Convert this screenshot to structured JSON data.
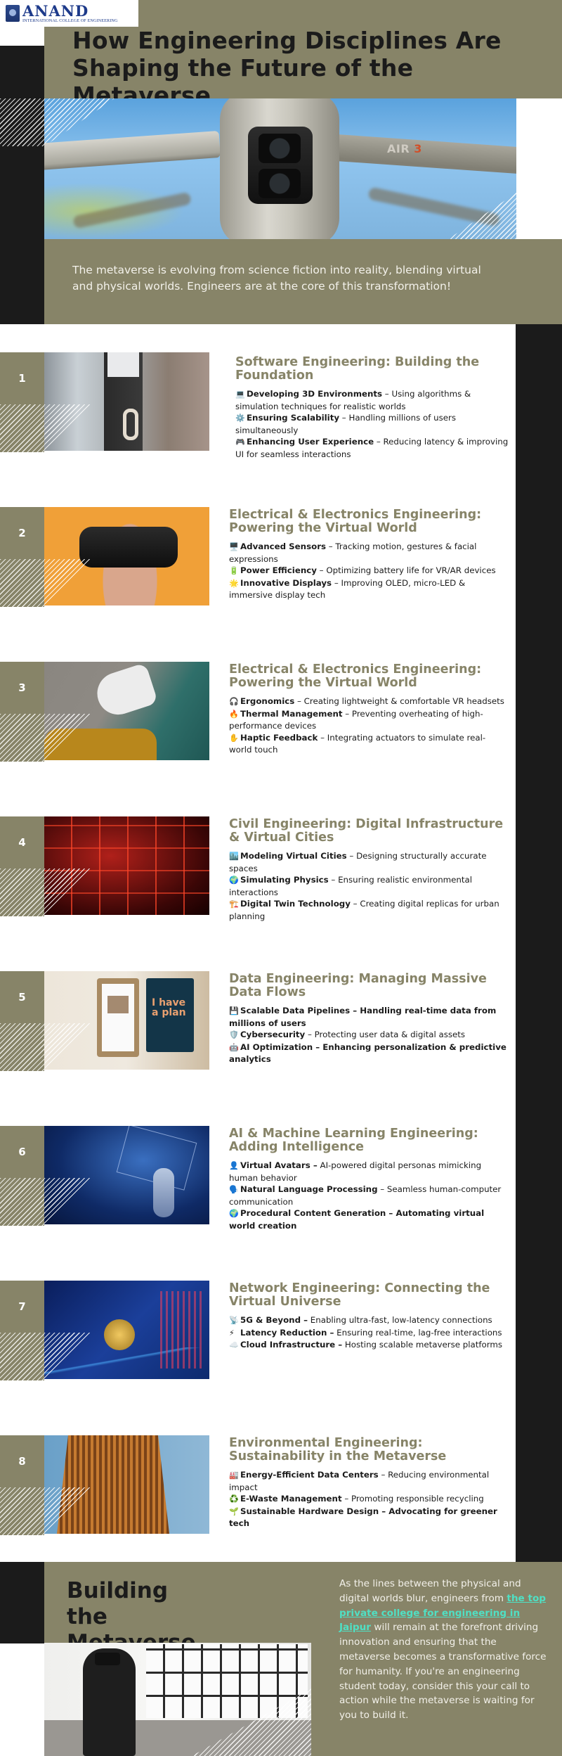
{
  "logo": {
    "name": "ANAND",
    "subtitle": "INTERNATIONAL COLLEGE OF ENGINEERING"
  },
  "header": {
    "title": "How Engineering Disciplines Are Shaping the Future of the Metaverse",
    "hero_image_label": "AIR 3",
    "hero_image_label_accent": "3"
  },
  "intro": {
    "text": "The metaverse is evolving from science fiction into reality, blending virtual and physical worlds. Engineers are at the core of this transformation!"
  },
  "sections": [
    {
      "number": "1",
      "title": "Software Engineering: Building the Foundation",
      "image": "person-holding-vr-headset",
      "items": [
        {
          "icon": "💻",
          "icon_name": "laptop-icon",
          "label": "Developing 3D Environments",
          "text": " – Using algorithms & simulation techniques for realistic worlds"
        },
        {
          "icon": "⚙️",
          "icon_name": "gear-icon",
          "label": "Ensuring Scalability",
          "text": " – Handling millions of users simultaneously"
        },
        {
          "icon": "🎮",
          "icon_name": "game-controller-icon",
          "label": "Enhancing User Experience",
          "text": " – Reducing latency & improving UI for seamless interactions"
        }
      ]
    },
    {
      "number": "2",
      "title": "Electrical & Electronics Engineering: Powering the Virtual World",
      "image": "woman-wearing-vr-headset",
      "items": [
        {
          "icon": "🖥️",
          "icon_name": "desktop-icon",
          "label": "Advanced Sensors",
          "text": " – Tracking motion, gestures & facial expressions"
        },
        {
          "icon": "🔋",
          "icon_name": "battery-icon",
          "label": "Power Efficiency",
          "text": " – Optimizing battery life for VR/AR devices"
        },
        {
          "icon": "🌟",
          "icon_name": "star-icon",
          "label": "Innovative Displays",
          "text": " – Improving OLED, micro-LED & immersive display tech"
        }
      ]
    },
    {
      "number": "3",
      "title": "Electrical & Electronics Engineering: Powering the Virtual World",
      "image": "person-resting-with-vr-headset",
      "items": [
        {
          "icon": "🎧",
          "icon_name": "headphones-icon",
          "label": "Ergonomics",
          "text": " – Creating lightweight & comfortable VR headsets"
        },
        {
          "icon": "🔥",
          "icon_name": "fire-icon",
          "label": "Thermal Management",
          "text": " – Preventing overheating of high-performance devices"
        },
        {
          "icon": "✋",
          "icon_name": "hand-icon",
          "label": "Haptic Feedback",
          "text": " – Integrating actuators to simulate real-world touch"
        }
      ]
    },
    {
      "number": "4",
      "title": "Civil Engineering: Digital Infrastructure & Virtual Cities",
      "image": "red-neon-grid",
      "items": [
        {
          "icon": "🏙️",
          "icon_name": "city-icon",
          "label": "Modeling Virtual Cities",
          "text": " – Designing structurally accurate spaces"
        },
        {
          "icon": "🌍",
          "icon_name": "globe-icon",
          "label": "Simulating Physics",
          "text": " – Ensuring realistic environmental interactions"
        },
        {
          "icon": "🏗️",
          "icon_name": "construction-icon",
          "label": "Digital Twin Technology",
          "text": " – Creating digital replicas for urban planning"
        }
      ]
    },
    {
      "number": "5",
      "title": "Data Engineering: Managing Massive Data Flows",
      "image": "clipboard-and-notebook",
      "items": [
        {
          "icon": "💾",
          "icon_name": "floppy-disk-icon",
          "label": "Scalable Data Pipelines – Handling real-time data from millions of users",
          "text": ""
        },
        {
          "icon": "🛡️",
          "icon_name": "shield-icon",
          "label": "Cybersecurity",
          "text": " – Protecting user data & digital assets"
        },
        {
          "icon": "🤖",
          "icon_name": "robot-icon",
          "label": "AI Optimization – Enhancing personalization & predictive analytics",
          "text": ""
        }
      ]
    },
    {
      "number": "6",
      "title": "AI & Machine Learning Engineering: Adding Intelligence",
      "image": "robot-hand-network",
      "items": [
        {
          "icon": "👤",
          "icon_name": "user-icon",
          "label": "Virtual Avatars –",
          "text": " AI-powered digital personas mimicking human behavior"
        },
        {
          "icon": "🗣️",
          "icon_name": "speaking-head-icon",
          "label": "Natural Language Processing",
          "text": " – Seamless human-computer communication"
        },
        {
          "icon": "🌍",
          "icon_name": "globe-icon",
          "label": "Procedural Content Generation – Automating virtual world creation",
          "text": ""
        }
      ]
    },
    {
      "number": "7",
      "title": "Network Engineering: Connecting the Virtual Universe",
      "image": "bitcoin-chart",
      "items": [
        {
          "icon": "📡",
          "icon_name": "satellite-antenna-icon",
          "label": "5G & Beyond –",
          "text": " Enabling ultra-fast, low-latency connections"
        },
        {
          "icon": "⚡",
          "icon_name": "lightning-icon",
          "label": "Latency Reduction –",
          "text": " Ensuring real-time, lag-free interactions"
        },
        {
          "icon": "☁️",
          "icon_name": "cloud-icon",
          "label": "Cloud Infrastructure –",
          "text": " Hosting scalable metaverse platforms"
        }
      ]
    },
    {
      "number": "8",
      "title": "Environmental Engineering: Sustainability in the Metaverse",
      "image": "wooden-tower",
      "items": [
        {
          "icon": "🏭",
          "icon_name": "factory-icon",
          "label": "Energy-Efficient Data Centers",
          "text": " – Reducing environmental impact"
        },
        {
          "icon": "♻️",
          "icon_name": "recycle-icon",
          "label": "E-Waste Management",
          "text": " – Promoting responsible recycling"
        },
        {
          "icon": "🌱",
          "icon_name": "seedling-icon",
          "label": "Sustainable Hardware Design – Advocating for greener tech",
          "text": ""
        }
      ]
    }
  ],
  "conclusion": {
    "title": "Building the Metaverse",
    "text_before": "As the lines between the physical and digital worlds blur, engineers from ",
    "link_text": "the top private college for engineering in Jaipur",
    "text_after": " will remain at the forefront driving innovation and ensuring that the metaverse becomes a transformative force for humanity. If you're an engineering student today, consider this your call to action while the metaverse is waiting for you to build it."
  },
  "colors": {
    "olive": "#878468",
    "dark": "#1b1b1b",
    "link": "#4fe0c4"
  }
}
